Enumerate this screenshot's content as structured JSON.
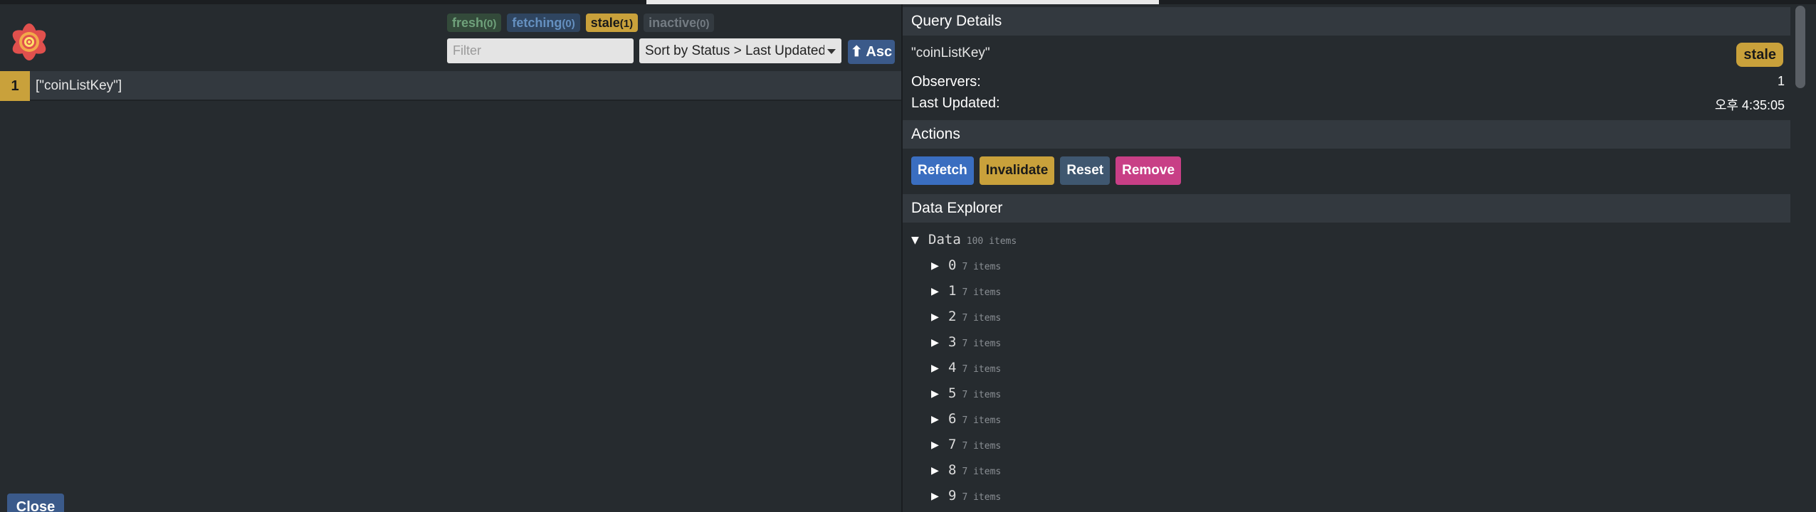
{
  "counts": {
    "fresh": {
      "label": "fresh",
      "num": "(0)"
    },
    "fetching": {
      "label": "fetching",
      "num": "(0)"
    },
    "stale": {
      "label": "stale",
      "num": "(1)"
    },
    "inactive": {
      "label": "inactive",
      "num": "(0)"
    }
  },
  "filter": {
    "placeholder": "Filter",
    "value": ""
  },
  "sort": {
    "selected": "Sort by Status > Last Updated"
  },
  "asc_label": "⬆ Asc",
  "query_list": [
    {
      "observers": "1",
      "key": "[\"coinListKey\"]"
    }
  ],
  "close_label": "Close",
  "details": {
    "title": "Query Details",
    "key": "\"coinListKey\"",
    "status": "stale",
    "observers_label": "Observers:",
    "observers_value": "1",
    "updated_label": "Last Updated:",
    "updated_value": "오후 4:35:05"
  },
  "actions": {
    "title": "Actions",
    "refetch": "Refetch",
    "invalidate": "Invalidate",
    "reset": "Reset",
    "remove": "Remove"
  },
  "explorer": {
    "title": "Data Explorer",
    "root": {
      "label": "Data",
      "meta": "100 items"
    },
    "children": [
      {
        "label": "0",
        "meta": "7 items"
      },
      {
        "label": "1",
        "meta": "7 items"
      },
      {
        "label": "2",
        "meta": "7 items"
      },
      {
        "label": "3",
        "meta": "7 items"
      },
      {
        "label": "4",
        "meta": "7 items"
      },
      {
        "label": "5",
        "meta": "7 items"
      },
      {
        "label": "6",
        "meta": "7 items"
      },
      {
        "label": "7",
        "meta": "7 items"
      },
      {
        "label": "8",
        "meta": "7 items"
      },
      {
        "label": "9",
        "meta": "7 items"
      }
    ]
  },
  "icons": {
    "logo": "react-query-flower-logo",
    "expanded": "triangle-down-icon",
    "collapsed": "triangle-right-icon",
    "sort": "chevron-down-icon"
  },
  "colors": {
    "stale": "#c9a13b",
    "refetch": "#3a6ec0",
    "remove": "#c83f86",
    "reset": "#3f5770",
    "panel_bg": "#262b2f",
    "section_bg": "#33393f"
  }
}
